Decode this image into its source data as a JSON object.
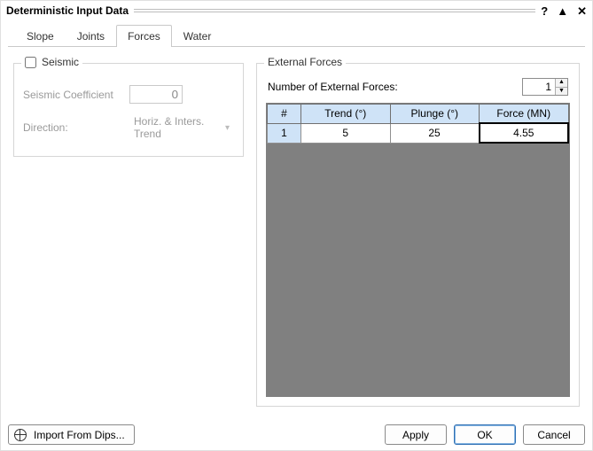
{
  "title": "Deterministic Input Data",
  "titlebar_controls": {
    "help": "?",
    "collapse": "▲",
    "close": "✕"
  },
  "tabs": [
    {
      "label": "Slope",
      "active": false
    },
    {
      "label": "Joints",
      "active": false
    },
    {
      "label": "Forces",
      "active": true
    },
    {
      "label": "Water",
      "active": false
    }
  ],
  "seismic": {
    "legend": "Seismic",
    "checked": false,
    "coeff_label": "Seismic Coefficient",
    "coeff_value": "0",
    "direction_label": "Direction:",
    "direction_value": "Horiz. & Inters. Trend"
  },
  "external": {
    "legend": "External Forces",
    "count_label": "Number of External Forces:",
    "count_value": "1",
    "columns": {
      "hash": "#",
      "trend": "Trend (°)",
      "plunge": "Plunge (°)",
      "force": "Force (MN)"
    },
    "rows": [
      {
        "n": "1",
        "trend": "5",
        "plunge": "25",
        "force": "4.55"
      }
    ],
    "selected_cell": "force"
  },
  "footer": {
    "import": "Import From Dips...",
    "apply": "Apply",
    "ok": "OK",
    "cancel": "Cancel"
  }
}
